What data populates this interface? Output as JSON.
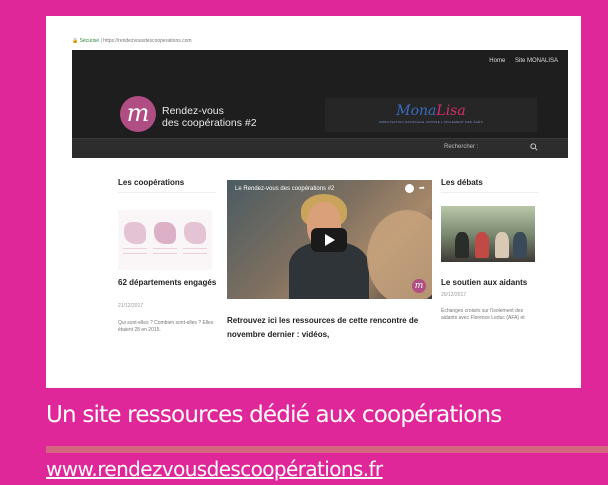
{
  "colors": {
    "background": "#e0279a",
    "header": "#1e1e1e",
    "logo": "#b04d82",
    "divider": "#d4667f"
  },
  "browser": {
    "secure_label": "Sécurisé",
    "url": "https://rendezvousdescooperations.com"
  },
  "site": {
    "top_links": [
      "Home",
      "Site MONALISA"
    ],
    "logo_letter": "m",
    "title_line1": "Rendez-vous",
    "title_line2": "des coopérations #2",
    "partner_script_a": "Mona",
    "partner_script_b": "Lisa",
    "partner_tagline": "MOBILISATION NATIONALE CONTRE L'ISOLEMENT DES ÂGÉS",
    "search_label": "Rechercher :",
    "icons": [
      "search-icon",
      "play-icon",
      "share-icon"
    ]
  },
  "left_column": {
    "heading": "Les coopérations",
    "card_title": "62 départements engagés",
    "card_date": "21/12/2017",
    "card_excerpt": "Qui sont-elles ? Combien sont-elles ? Elles étaient 28 en 2015."
  },
  "center_column": {
    "video_title": "Le Rendez-vous des coopérations #2",
    "intro_text": "Retrouvez ici les ressources de cette rencontre de novembre dernier : vidéos,"
  },
  "right_column": {
    "heading": "Les débats",
    "card_title": "Le soutien aux aidants",
    "card_date": "20/12/2017",
    "card_excerpt": "Échanges croisés sur l'isolement des aidants avec Florence Leduc (AFA) et"
  },
  "caption": {
    "headline": "Un site ressources dédié aux coopérations",
    "link": "www.rendezvousdescoopérations.fr"
  }
}
